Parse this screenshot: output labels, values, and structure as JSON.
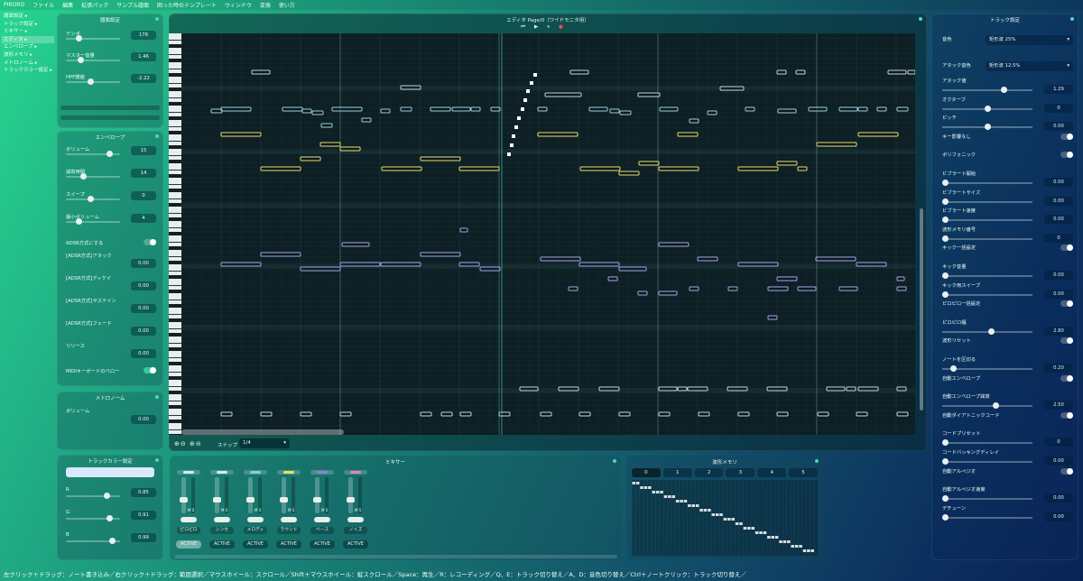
{
  "menu": [
    "PIRORO",
    "ファイル",
    "編集",
    "拡張パック",
    "サンプル譜面",
    "困った時のテンプレート",
    "ウィンドウ",
    "変換",
    "使い方"
  ],
  "nav": [
    "譜面設定 ▸",
    "トラック設定 ▸",
    "ミキサー ▸",
    "エディタ ▸",
    "エンベロープ ▸",
    "波形メモリ ▸",
    "メトロノーム ▸",
    "トラックカラー設定 ▸"
  ],
  "score": {
    "title": "譜面設定",
    "rows": [
      {
        "label": "テンポ",
        "value": "178",
        "pos": 0.2
      },
      {
        "label": "マスター音量",
        "value": "1.46",
        "pos": 0.25
      },
      {
        "label": "HPF閾値",
        "value": "-2.22",
        "pos": 0.45
      }
    ]
  },
  "envelope": {
    "title": "エンベロープ",
    "rows": [
      {
        "label": "ボリューム",
        "value": "15",
        "pos": 0.85
      },
      {
        "label": "減衰時間",
        "value": "14",
        "pos": 0.3
      },
      {
        "label": "スイープ",
        "value": "0",
        "pos": 0.45
      },
      {
        "label": "最小ボリューム",
        "value": "4",
        "pos": 0.2
      }
    ],
    "toggle_label": "ADSR方式にする",
    "adsr": [
      {
        "label": "[ADSR方式]アタック",
        "value": "0.00"
      },
      {
        "label": "[ADSR方式]ディケイ",
        "value": "0.00"
      },
      {
        "label": "[ADSR方式]サステイン",
        "value": "0.00"
      },
      {
        "label": "[ADSR方式]フェード",
        "value": "0.00"
      },
      {
        "label": "リリース",
        "value": "0.00"
      }
    ],
    "midi_label": "MIDIキーボードのベロー"
  },
  "metronome": {
    "title": "メトロノーム",
    "label": "ボリューム",
    "value": "0.00"
  },
  "trackcolor": {
    "title": "トラックカラー設定",
    "rows": [
      {
        "label": "R",
        "value": "0.85",
        "pos": 0.8
      },
      {
        "label": "G",
        "value": "0.91",
        "pos": 0.85
      },
      {
        "label": "B",
        "value": "0.99",
        "pos": 0.9
      }
    ]
  },
  "editor": {
    "title": "エディタ Page/0（ワイドモニタ用）",
    "snap_label": "スナップ",
    "snap_value": "1/4",
    "transport": [
      "⏮",
      "▶",
      "⏸",
      "●"
    ]
  },
  "mixer": {
    "title": "ミキサー",
    "channels": [
      {
        "name": "ピロピロ",
        "color": "#d8e8f0",
        "active": "ACTIVE"
      },
      {
        "name": "シンセ",
        "color": "#d8e8f0",
        "active": "ACTIVE"
      },
      {
        "name": "メロディ",
        "color": "#7fd0e0",
        "active": "ACTIVE"
      },
      {
        "name": "ラウンド",
        "color": "#e8e060",
        "active": "ACTIVE"
      },
      {
        "name": "ベース",
        "color": "#9080e0",
        "active": "ACTIVE"
      },
      {
        "name": "ノイズ",
        "color": "#e080c0",
        "active": "ACTIVE"
      }
    ]
  },
  "wave": {
    "title": "波形メモリ",
    "tabs": [
      "0",
      "1",
      "2",
      "3",
      "4",
      "5"
    ],
    "levels": [
      15,
      15,
      14,
      14,
      14,
      13,
      13,
      13,
      12,
      12,
      12,
      11,
      11,
      11,
      10,
      10,
      10,
      9,
      9,
      9,
      8,
      8,
      8,
      7,
      7,
      7,
      6,
      6,
      5,
      5,
      5,
      4,
      4,
      4,
      3,
      3,
      3,
      2,
      2,
      2,
      1,
      1,
      1,
      0,
      0,
      0
    ]
  },
  "track": {
    "title": "トラック設定",
    "selects": [
      {
        "label": "音色",
        "value": "矩形波 25%"
      },
      {
        "label": "アタック音色",
        "value": "矩形波 12.5%"
      }
    ],
    "rows": [
      {
        "label": "アタック値",
        "type": "slider",
        "value": "1.29",
        "pos": 0.7
      },
      {
        "label": "オクターブ",
        "type": "slider",
        "value": "0",
        "pos": 0.5
      },
      {
        "label": "ピッチ",
        "type": "slider",
        "value": "0.00",
        "pos": 0.5
      },
      {
        "label": "キー影響なし",
        "type": "toggle"
      },
      {
        "label": "ポリフォニック",
        "type": "toggle"
      },
      {
        "label": "ビブラート開始",
        "type": "slider",
        "value": "0.00",
        "pos": 0.0
      },
      {
        "label": "ビブラートサイズ",
        "type": "slider",
        "value": "0.00",
        "pos": 0.0
      },
      {
        "label": "ビブラート速度",
        "type": "slider",
        "value": "0.00",
        "pos": 0.0
      },
      {
        "label": "波形メモリ番号",
        "type": "slider",
        "value": "0",
        "pos": 0.0
      },
      {
        "label": "キック一括設定",
        "type": "toggle"
      },
      {
        "label": "キック音量",
        "type": "slider",
        "value": "0.00",
        "pos": 0.0
      },
      {
        "label": "キック用スイープ",
        "type": "slider",
        "value": "0.00",
        "pos": 0.0
      },
      {
        "label": "ピロピロ一括設定",
        "type": "toggle"
      },
      {
        "label": "ピロピロ幅",
        "type": "slider",
        "value": "2.80",
        "pos": 0.55
      },
      {
        "label": "波形リセット",
        "type": "toggle"
      },
      {
        "label": "ノートを区切る",
        "type": "slider",
        "value": "0.20",
        "pos": 0.1
      },
      {
        "label": "自動エンベロープ",
        "type": "toggle"
      },
      {
        "label": "自動エンベロープ減衰",
        "type": "slider",
        "value": "2.50",
        "pos": 0.6
      },
      {
        "label": "自動ダイアトニックコード",
        "type": "toggle"
      },
      {
        "label": "コードプリセット",
        "type": "slider",
        "value": "0",
        "pos": 0.0
      },
      {
        "label": "コードバッキングディレイ",
        "type": "slider",
        "value": "0.00",
        "pos": 0.0
      },
      {
        "label": "自動アルペジオ",
        "type": "toggle"
      },
      {
        "label": "自動アルペジオ速度",
        "type": "slider",
        "value": "0.00",
        "pos": 0.0
      },
      {
        "label": "デチューン",
        "type": "slider",
        "value": "0.00",
        "pos": 0.0
      }
    ]
  },
  "status": "左クリック＋ドラッグ：ノート書き込み／右クリック＋ドラッグ：範囲選択／マウスホイール：スクロール／Shift＋マウスホイール：縦スクロール／Space：再生／R：レコーディング／Q、E：トラック切り替え／A、D：音色切り替え／Ctrl＋ノートクリック：トラック切り替え／"
}
